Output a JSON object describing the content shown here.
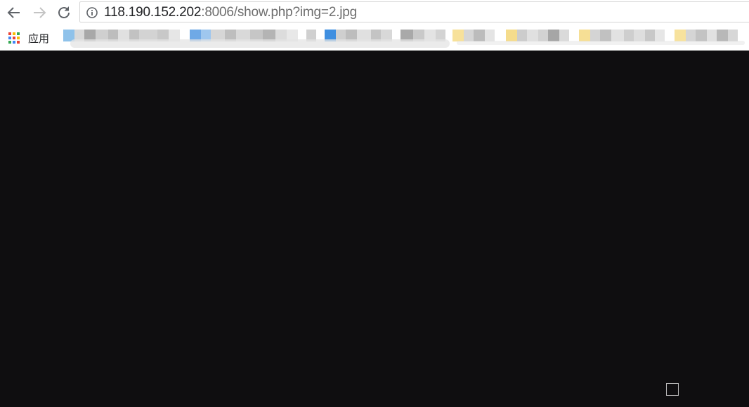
{
  "browser": {
    "url_host": "118.190.152.202",
    "url_rest": ":8006/show.php?img=2.jpg",
    "apps_label": "应用",
    "icons": {
      "back": "back-arrow-icon",
      "forward": "forward-arrow-icon",
      "reload": "reload-icon",
      "info": "info-icon",
      "apps": "apps-grid-icon"
    }
  },
  "colors": {
    "page_background": "#0f0e10",
    "chrome_background": "#ffffff",
    "url_host": "#202124",
    "url_rest": "#6e6e6e"
  }
}
